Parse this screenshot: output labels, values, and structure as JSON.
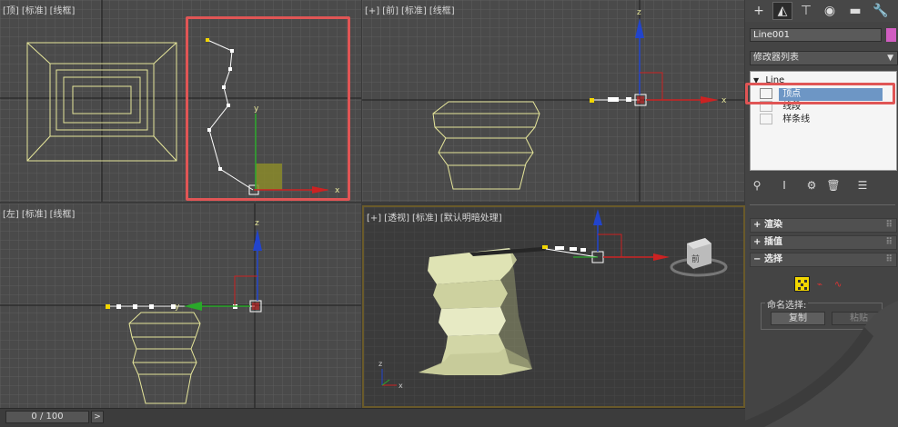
{
  "viewports": {
    "top": {
      "label": [
        "[顶]",
        "[标准]",
        "[线框]"
      ]
    },
    "front": {
      "label": [
        "[+]",
        "[前]",
        "[标准]",
        "[线框]"
      ]
    },
    "left": {
      "label": [
        "[左]",
        "[标准]",
        "[线框]"
      ]
    },
    "perspective": {
      "label": [
        "[+]",
        "[透视]",
        "[标准]",
        "[默认明暗处理]"
      ]
    }
  },
  "axis": {
    "x": "x",
    "y": "y",
    "z": "z"
  },
  "command_panel": {
    "tabs": [
      {
        "icon": "create-plus-icon",
        "glyph": "+"
      },
      {
        "icon": "modify-icon",
        "glyph": "◭"
      },
      {
        "icon": "hierarchy-icon",
        "glyph": "⊤"
      },
      {
        "icon": "motion-icon",
        "glyph": "◉"
      },
      {
        "icon": "display-icon",
        "glyph": "▬"
      },
      {
        "icon": "utilities-icon",
        "glyph": "🔧"
      }
    ],
    "object_name": "Line001",
    "object_color": "#d15dc1",
    "modifier_list": "修改器列表",
    "stack": {
      "root": "Line",
      "items": [
        "顶点",
        "线段",
        "样条线"
      ],
      "selected_index": 0
    },
    "rollouts": [
      "渲染",
      "插值",
      "选择"
    ],
    "named_selection_label": "命名选择:",
    "copy_button": "复制",
    "paste_button": "粘贴"
  },
  "timeline": {
    "frame": "0 / 100",
    "next": ">"
  },
  "colors": {
    "highlight": "#e05555",
    "selected_row": "#6d96c5",
    "vertex_yellow": "#f2d600"
  }
}
